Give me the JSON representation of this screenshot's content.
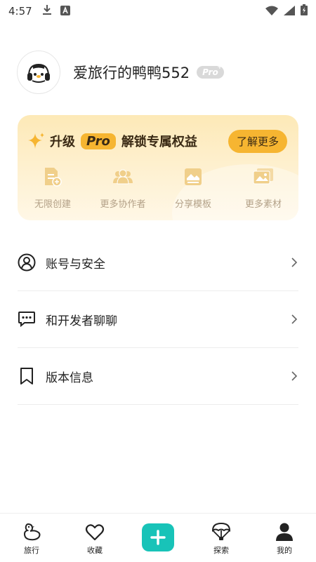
{
  "status_bar": {
    "time": "4:57",
    "left_icons": [
      "download-icon",
      "a-icon"
    ],
    "right_icons": [
      "wifi-icon",
      "signal-icon",
      "battery-icon"
    ]
  },
  "profile": {
    "username": "爱旅行的鸭鸭552",
    "badge": "Pro",
    "badge_plus": "+"
  },
  "pro_card": {
    "prefix": "升级",
    "pill": "Pro",
    "suffix": "解锁专属权益",
    "button": "了解更多",
    "features": [
      {
        "label": "无限创建",
        "icon": "create-doc-icon"
      },
      {
        "label": "更多协作者",
        "icon": "collaborators-icon"
      },
      {
        "label": "分享模板",
        "icon": "template-icon"
      },
      {
        "label": "更多素材",
        "icon": "materials-icon"
      }
    ],
    "colors": {
      "accent": "#f6b531",
      "feature_icon": "#f0cf8a",
      "feature_text": "#b3a188"
    }
  },
  "menu": [
    {
      "label": "账号与安全",
      "icon": "user-circle-icon"
    },
    {
      "label": "和开发者聊聊",
      "icon": "chat-icon"
    },
    {
      "label": "版本信息",
      "icon": "bookmark-icon"
    }
  ],
  "bottom_nav": [
    {
      "label": "旅行",
      "icon": "duck-icon"
    },
    {
      "label": "收藏",
      "icon": "heart-icon"
    },
    {
      "label": "",
      "icon": "add-icon"
    },
    {
      "label": "探索",
      "icon": "parachute-icon"
    },
    {
      "label": "我的",
      "icon": "person-icon"
    }
  ],
  "colors": {
    "primary_teal": "#18c3b8",
    "text": "#222222",
    "divider": "#ededed"
  }
}
